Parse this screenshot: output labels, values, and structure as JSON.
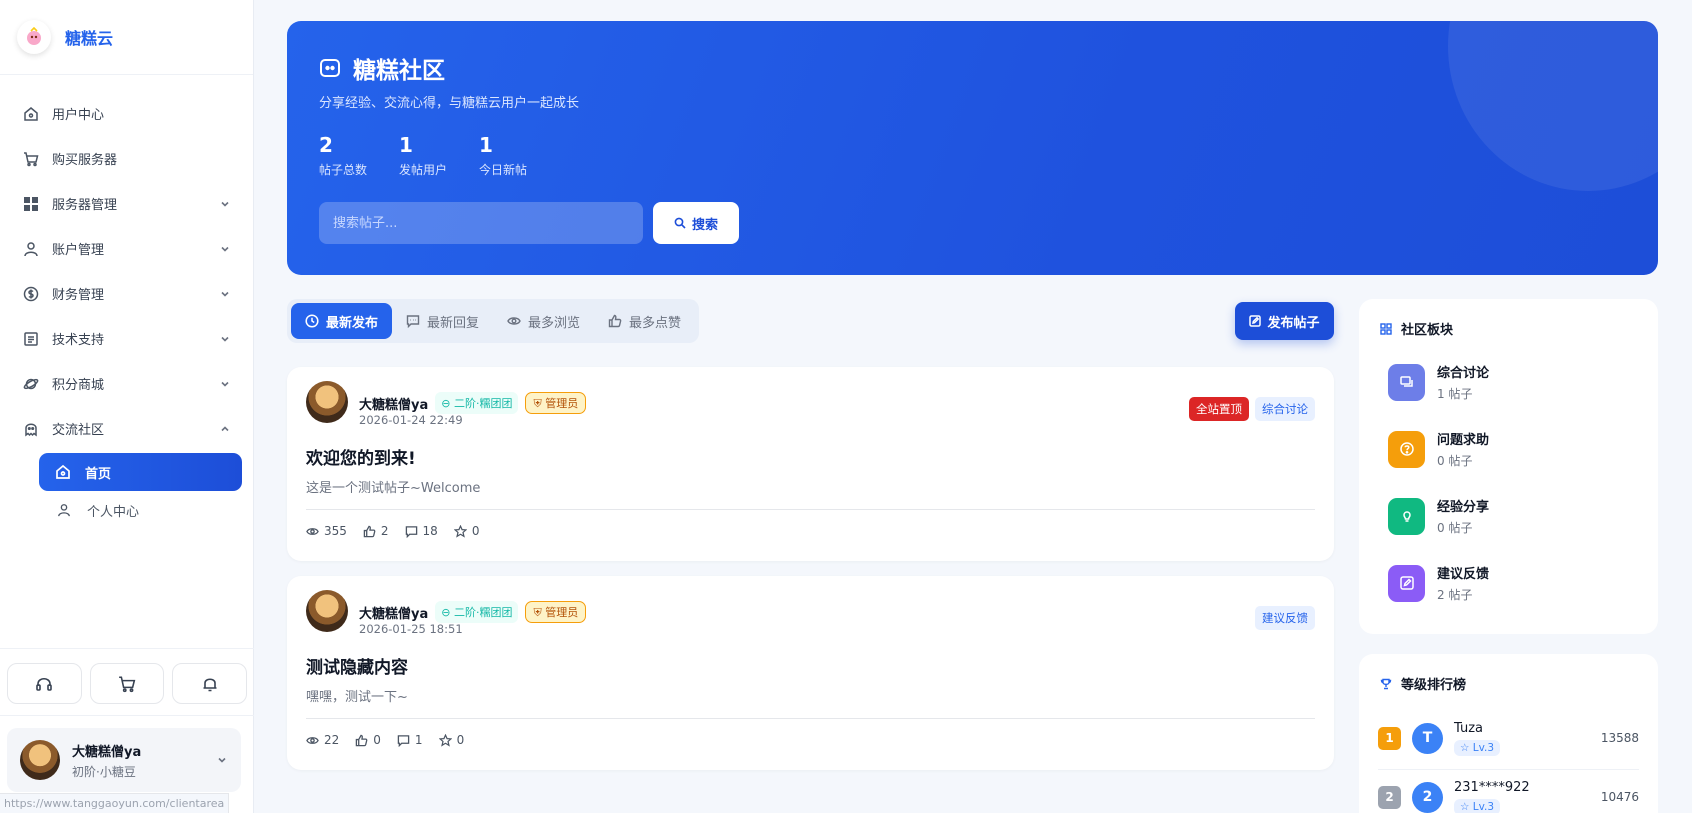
{
  "brand": {
    "name": "糖糕云"
  },
  "sidebar": {
    "items": [
      {
        "label": "用户中心",
        "icon": "home-icon"
      },
      {
        "label": "购买服务器",
        "icon": "cart-icon"
      },
      {
        "label": "服务器管理",
        "icon": "grid-icon"
      },
      {
        "label": "账户管理",
        "icon": "user-icon"
      },
      {
        "label": "财务管理",
        "icon": "dollar-icon"
      },
      {
        "label": "技术支持",
        "icon": "document-icon"
      },
      {
        "label": "积分商城",
        "icon": "planet-icon"
      },
      {
        "label": "交流社区",
        "icon": "ghost-icon"
      }
    ],
    "subitems": [
      {
        "label": "首页",
        "active": true
      },
      {
        "label": "个人中心",
        "active": false
      }
    ]
  },
  "quick_actions": [
    "headset-icon",
    "cart-icon",
    "bell-icon"
  ],
  "current_user": {
    "name": "大糖糕僧ya",
    "level": "初阶·小糖豆"
  },
  "status_bar": {
    "url": "https://www.tanggaoyun.com/clientarea"
  },
  "hero": {
    "title": "糖糕社区",
    "subtitle": "分享经验、交流心得，与糖糕云用户一起成长",
    "stats": [
      {
        "value": "2",
        "label": "帖子总数"
      },
      {
        "value": "1",
        "label": "发帖用户"
      },
      {
        "value": "1",
        "label": "今日新帖"
      }
    ],
    "search_placeholder": "搜索帖子...",
    "search_button": "搜索"
  },
  "tabs": [
    {
      "label": "最新发布",
      "active": true
    },
    {
      "label": "最新回复",
      "active": false
    },
    {
      "label": "最多浏览",
      "active": false
    },
    {
      "label": "最多点赞",
      "active": false
    }
  ],
  "new_post_button": "发布帖子",
  "posts": [
    {
      "author": "大糖糕僧ya",
      "level": "二阶·糯团团",
      "role": "管理员",
      "time": "2026-01-24 22:49",
      "pinned": "全站置顶",
      "category": "综合讨论",
      "title": "欢迎您的到来!",
      "excerpt": "这是一个测试帖子~Welcome",
      "views": "355",
      "likes": "2",
      "comments": "18",
      "favorites": "0"
    },
    {
      "author": "大糖糕僧ya",
      "level": "二阶·糯团团",
      "role": "管理员",
      "time": "2026-01-25 18:51",
      "category": "建议反馈",
      "title": "测试隐藏内容",
      "excerpt": "嘿嘿，测试一下~",
      "views": "22",
      "likes": "0",
      "comments": "1",
      "favorites": "0"
    }
  ],
  "boards": {
    "title": "社区板块",
    "items": [
      {
        "name": "综合讨论",
        "count": "1 帖子",
        "color": "#6d7ee8"
      },
      {
        "name": "问题求助",
        "count": "0 帖子",
        "color": "#f59e0b"
      },
      {
        "name": "经验分享",
        "count": "0 帖子",
        "color": "#10b981"
      },
      {
        "name": "建议反馈",
        "count": "2 帖子",
        "color": "#8b5cf6"
      }
    ]
  },
  "ranking": {
    "title": "等级排行榜",
    "rows": [
      {
        "rank": "1",
        "initial": "T",
        "name": "Tuza",
        "level": "Lv.3",
        "score": "13588",
        "rank_color": "#f59e0b"
      },
      {
        "rank": "2",
        "initial": "2",
        "name": "231****922",
        "level": "Lv.3",
        "score": "10476",
        "rank_color": "#9ca3af"
      }
    ]
  }
}
